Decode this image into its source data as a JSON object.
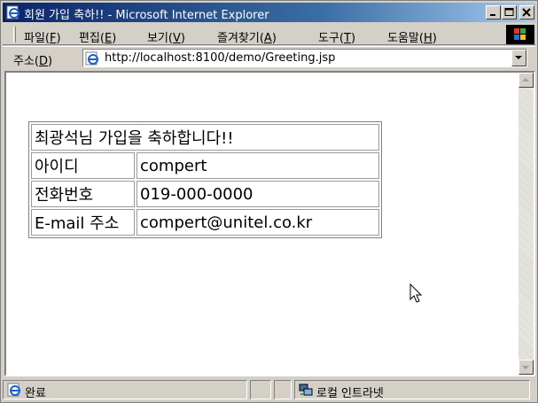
{
  "window": {
    "title": "회원 가입 축하!! - Microsoft Internet Explorer"
  },
  "menu": [
    {
      "pre": "파일(",
      "key": "F",
      "post": ")"
    },
    {
      "pre": "편집(",
      "key": "E",
      "post": ")"
    },
    {
      "pre": "보기(",
      "key": "V",
      "post": ")"
    },
    {
      "pre": "즐겨찾기(",
      "key": "A",
      "post": ")"
    },
    {
      "pre": "도구(",
      "key": "T",
      "post": ")"
    },
    {
      "pre": "도움말(",
      "key": "H",
      "post": ")"
    }
  ],
  "address": {
    "label_pre": "주소(",
    "label_key": "D",
    "label_post": ")",
    "url": "http://localhost:8100/demo/Greeting.jsp"
  },
  "greeting_table": {
    "header": "최광석님 가입을 축하합니다!!",
    "rows": [
      {
        "label": "아이디",
        "value": "compert"
      },
      {
        "label": "전화번호",
        "value": "019-000-0000"
      },
      {
        "label": "E-mail 주소",
        "value": "compert@unitel.co.kr"
      }
    ]
  },
  "status": {
    "text": "완료",
    "zone": "로컬 인트라넷"
  },
  "colors": {
    "title_start": "#0a246a",
    "title_end": "#a6caf0",
    "chrome": "#d4d0c8"
  },
  "icons": {
    "title": "ie-page-icon",
    "address": "ie-page-icon",
    "status": "ie-page-icon",
    "zone": "local-intranet-icon"
  }
}
